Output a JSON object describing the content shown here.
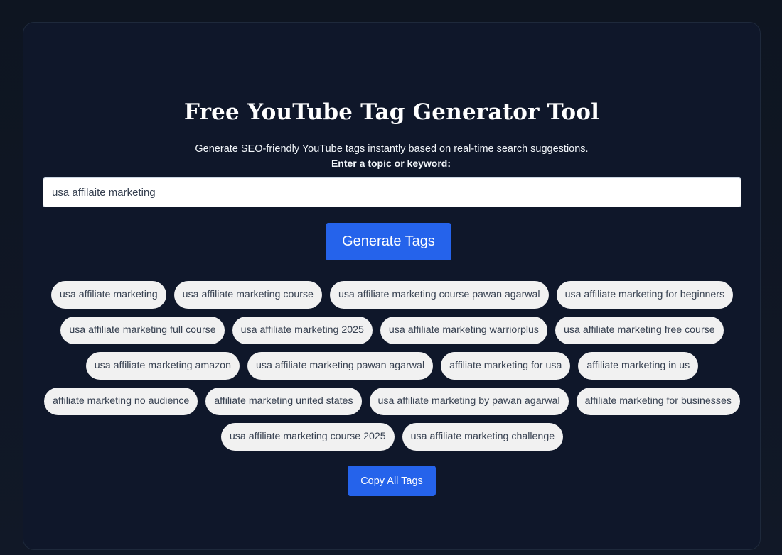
{
  "header": {
    "title": "Free YouTube Tag Generator Tool",
    "subtitle": "Generate SEO-friendly YouTube tags instantly based on real-time search suggestions."
  },
  "form": {
    "label": "Enter a topic or keyword:",
    "input_value": "usa affilaite marketing",
    "generate_label": "Generate Tags"
  },
  "tags": [
    "usa affiliate marketing",
    "usa affiliate marketing course",
    "usa affiliate marketing course pawan agarwal",
    "usa affiliate marketing for beginners",
    "usa affiliate marketing full course",
    "usa affiliate marketing 2025",
    "usa affiliate marketing warriorplus",
    "usa affiliate marketing free course",
    "usa affiliate marketing amazon",
    "usa affiliate marketing pawan agarwal",
    "affiliate marketing for usa",
    "affiliate marketing in us",
    "affiliate marketing no audience",
    "affiliate marketing united states",
    "usa affiliate marketing by pawan agarwal",
    "affiliate marketing for businesses",
    "usa affiliate marketing course 2025",
    "usa affiliate marketing challenge"
  ],
  "actions": {
    "copy_label": "Copy All Tags"
  },
  "colors": {
    "background": "#111827",
    "card": "#0f172a",
    "accent": "#2563eb",
    "tag_bg": "#f1f1f1"
  }
}
